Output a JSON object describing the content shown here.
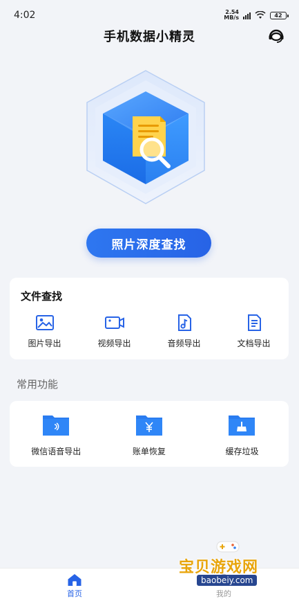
{
  "status_bar": {
    "time": "4:02",
    "net_speed_value": "2.54",
    "net_speed_unit": "MB/s",
    "battery": "42"
  },
  "header": {
    "title": "手机数据小精灵"
  },
  "hero": {
    "cta_label": "照片深度查找"
  },
  "file_search": {
    "title": "文件查找",
    "items": [
      {
        "label": "图片导出",
        "icon": "image-icon"
      },
      {
        "label": "视频导出",
        "icon": "video-icon"
      },
      {
        "label": "音频导出",
        "icon": "music-icon"
      },
      {
        "label": "文档导出",
        "icon": "document-icon"
      }
    ]
  },
  "common_features": {
    "title": "常用功能",
    "items": [
      {
        "label": "微信语音导出",
        "icon": "voice-folder-icon"
      },
      {
        "label": "账单恢复",
        "icon": "yen-folder-icon"
      },
      {
        "label": "缓存垃圾",
        "icon": "broom-folder-icon"
      }
    ]
  },
  "tab_bar": {
    "tabs": [
      {
        "label": "首页",
        "active": true
      },
      {
        "label": "我的",
        "active": false
      }
    ]
  },
  "watermark": {
    "text": "宝贝游戏网",
    "url": "baobeiy.com"
  },
  "colors": {
    "accent": "#2763e6",
    "background": "#f2f4f8"
  }
}
